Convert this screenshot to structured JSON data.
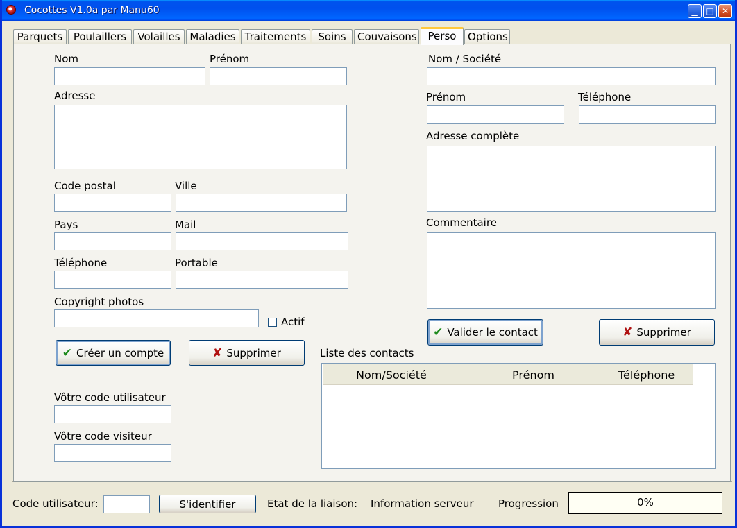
{
  "window": {
    "title": "Cocottes V1.0a par Manu60",
    "controls": {
      "minimize": "▁",
      "maximize": "□",
      "close": "✕"
    }
  },
  "tabs": [
    "Parquets",
    "Poulaillers",
    "Volailles",
    "Maladies",
    "Traitements",
    "Soins",
    "Couvaisons",
    "Perso",
    "Options"
  ],
  "active_tab": "Perso",
  "account": {
    "nom_label": "Nom",
    "prenom_label": "Prénom",
    "adresse_label": "Adresse",
    "code_postal_label": "Code postal",
    "ville_label": "Ville",
    "pays_label": "Pays",
    "mail_label": "Mail",
    "telephone_label": "Téléphone",
    "portable_label": "Portable",
    "copyright_label": "Copyright photos",
    "actif_label": "Actif",
    "create_button": "Créer un compte",
    "delete_button": "Supprimer",
    "user_code_label": "Vôtre code utilisateur",
    "visitor_code_label": "Vôtre code visiteur"
  },
  "contact": {
    "nom_societe_label": "Nom / Société",
    "prenom_label": "Prénom",
    "telephone_label": "Téléphone",
    "adresse_label": "Adresse complète",
    "commentaire_label": "Commentaire",
    "validate_button": "Valider le contact",
    "delete_button": "Supprimer"
  },
  "contact_list": {
    "label": "Liste des contacts",
    "columns": [
      "Nom/Société",
      "Prénom",
      "Téléphone"
    ],
    "rows": []
  },
  "status": {
    "code_label": "Code utilisateur:",
    "code_value": "",
    "identify_button": "S'identifier",
    "link_label": "Etat de la liaison:",
    "link_value": "Information serveur",
    "progress_label": "Progression",
    "progress_text": "0%"
  }
}
